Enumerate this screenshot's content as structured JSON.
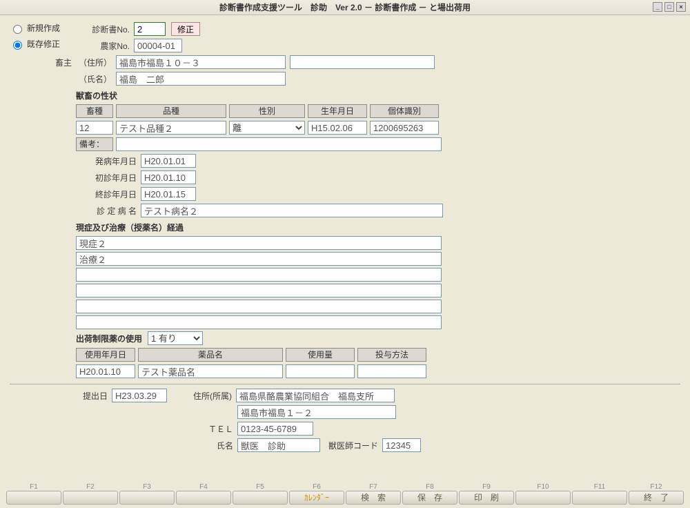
{
  "window": {
    "title": "診断書作成支援ツール　診助　Ver 2.0 － 診断書作成 － と場出荷用"
  },
  "mode": {
    "new_label": "新規作成",
    "edit_label": "既存修正"
  },
  "top": {
    "diag_no_label": "診断書No.",
    "diag_no_value": "2",
    "fix_btn": "修正",
    "farmer_no_label": "農家No.",
    "farmer_no_value": "00004-01"
  },
  "owner": {
    "label": "畜主",
    "addr_label": "（住所）",
    "addr_value": "福島市福島１０－３",
    "addr2_value": "",
    "name_label": "（氏名）",
    "name_value": "福島　二郎"
  },
  "animal": {
    "section": "獣畜の性状",
    "headers": {
      "kind": "畜種",
      "breed": "品種",
      "sex": "性別",
      "birth": "生年月日",
      "id": "個体識別"
    },
    "kind": "12",
    "breed": "テスト品種２",
    "sex": "離",
    "birth": "H15.02.06",
    "id": "1200695263",
    "remark_label": "備考：",
    "remark": ""
  },
  "dates": {
    "onset_label": "発病年月日",
    "onset": "H20.01.01",
    "first_label": "初診年月日",
    "first": "H20.01.10",
    "last_label": "終診年月日",
    "last": "H20.01.15",
    "diagnosis_label": "診 定 病 名",
    "diagnosis": "テスト病名２"
  },
  "course": {
    "section": "現症及び治療（授薬名）経過",
    "lines": [
      "現症２",
      "治療２",
      "",
      "",
      "",
      ""
    ]
  },
  "restricted": {
    "label": "出荷制限薬の使用",
    "select": "1 有り",
    "headers": {
      "date": "使用年月日",
      "name": "薬品名",
      "amount": "使用量",
      "method": "投与方法"
    },
    "row": {
      "date": "H20.01.10",
      "name": "テスト薬品名",
      "amount": "",
      "method": ""
    }
  },
  "submit": {
    "date_label": "提出日",
    "date": "H23.03.29",
    "addr_label": "住所(所属)",
    "addr1": "福島県酪農業協同組合　福島支所",
    "addr2": "福島市福島１－２",
    "tel_label": "ＴＥＬ",
    "tel": "0123-45-6789",
    "name_label": "氏名",
    "name": "獣医　診助",
    "vetcode_label": "獣医師コード",
    "vetcode": "12345"
  },
  "fkeys": {
    "labels": [
      "F1",
      "F2",
      "F3",
      "F4",
      "F5",
      "F6",
      "F7",
      "F8",
      "F9",
      "F10",
      "F11",
      "F12"
    ],
    "buttons": [
      "",
      "",
      "",
      "",
      "",
      "ｶﾚﾝﾀﾞｰ",
      "検　索",
      "保　存",
      "印　刷",
      "",
      "",
      "終　了"
    ]
  }
}
